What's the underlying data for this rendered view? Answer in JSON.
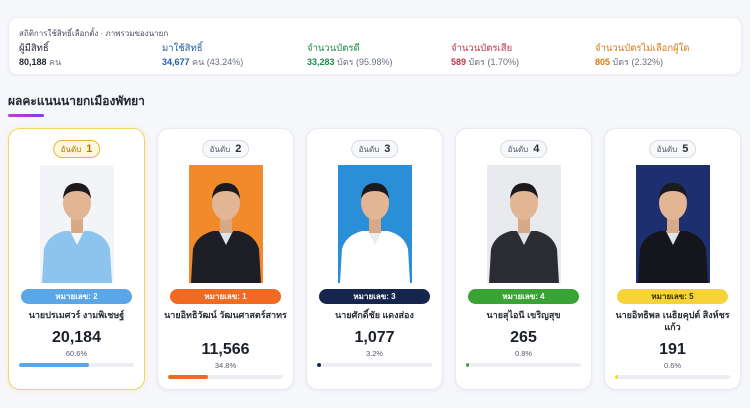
{
  "stats": {
    "title": "สถิติการใช้สิทธิ์เลือกตั้ง · ภาพรวมของนายก",
    "items": [
      {
        "label": "ผู้มีสิทธิ์",
        "value": "80,188",
        "unit": "คน",
        "extra": "",
        "color": "#1f2430"
      },
      {
        "label": "มาใช้สิทธิ์",
        "value": "34,677",
        "unit": "คน",
        "extra": "(43.24%)",
        "color": "#1f5fa8"
      },
      {
        "label": "จำนวนบัตรดี",
        "value": "33,283",
        "unit": "บัตร",
        "extra": "(95.98%)",
        "color": "#1e8a4c"
      },
      {
        "label": "จำนวนบัตรเสีย",
        "value": "589",
        "unit": "บัตร",
        "extra": "(1.70%)",
        "color": "#c2334d"
      },
      {
        "label": "จำนวนบัตรไม่เลือกผู้ใด",
        "value": "805",
        "unit": "บัตร",
        "extra": "(2.32%)",
        "color": "#d47a15"
      }
    ]
  },
  "section_title": "ผลคะแนนนายกเมืองพัทยา",
  "rank_label": "อันดับ",
  "candidates": [
    {
      "rank": "1",
      "badge": "หมายเลข: 2",
      "name": "นายปรเมศวร์ งามพิเชษฐ์",
      "votes": "20,184",
      "percent": "60.6%",
      "share": 0.606,
      "color": "#5aa6e6",
      "bg": "#f2f4f7",
      "shirt": "#8cc4ee",
      "suit": "light"
    },
    {
      "rank": "2",
      "badge": "หมายเลข: 1",
      "name": "นายอิทธิวัฒน์ วัฒนศาสตร์สาทร",
      "votes": "11,566",
      "percent": "34.8%",
      "share": 0.348,
      "color": "#f06a22",
      "bg": "#f08a2a",
      "shirt": "#1e1f26",
      "suit": "dark"
    },
    {
      "rank": "3",
      "badge": "หมายเลข: 3",
      "name": "นายศักดิ์ชัย แดงส่อง",
      "votes": "1,077",
      "percent": "3.2%",
      "share": 0.032,
      "color": "#15254d",
      "bg": "#2a8fd6",
      "shirt": "#ffffff",
      "suit": "white"
    },
    {
      "rank": "4",
      "badge": "หมายเลข: 4",
      "name": "นายสุไอนี เขริญสุข",
      "votes": "265",
      "percent": "0.8%",
      "share": 0.008,
      "color": "#3aa335",
      "bg": "#e8eaee",
      "shirt": "#2b2d33",
      "suit": "dark"
    },
    {
      "rank": "5",
      "badge": "หมายเลข: 5",
      "name": "นายอิทธิพล เนธิยคุปต์ สิงห์ชรแก้ว",
      "votes": "191",
      "percent": "0.6%",
      "share": 0.006,
      "color": "#f7d33a",
      "bg": "#1d2f6e",
      "shirt": "#15161b",
      "suit": "dark"
    }
  ]
}
